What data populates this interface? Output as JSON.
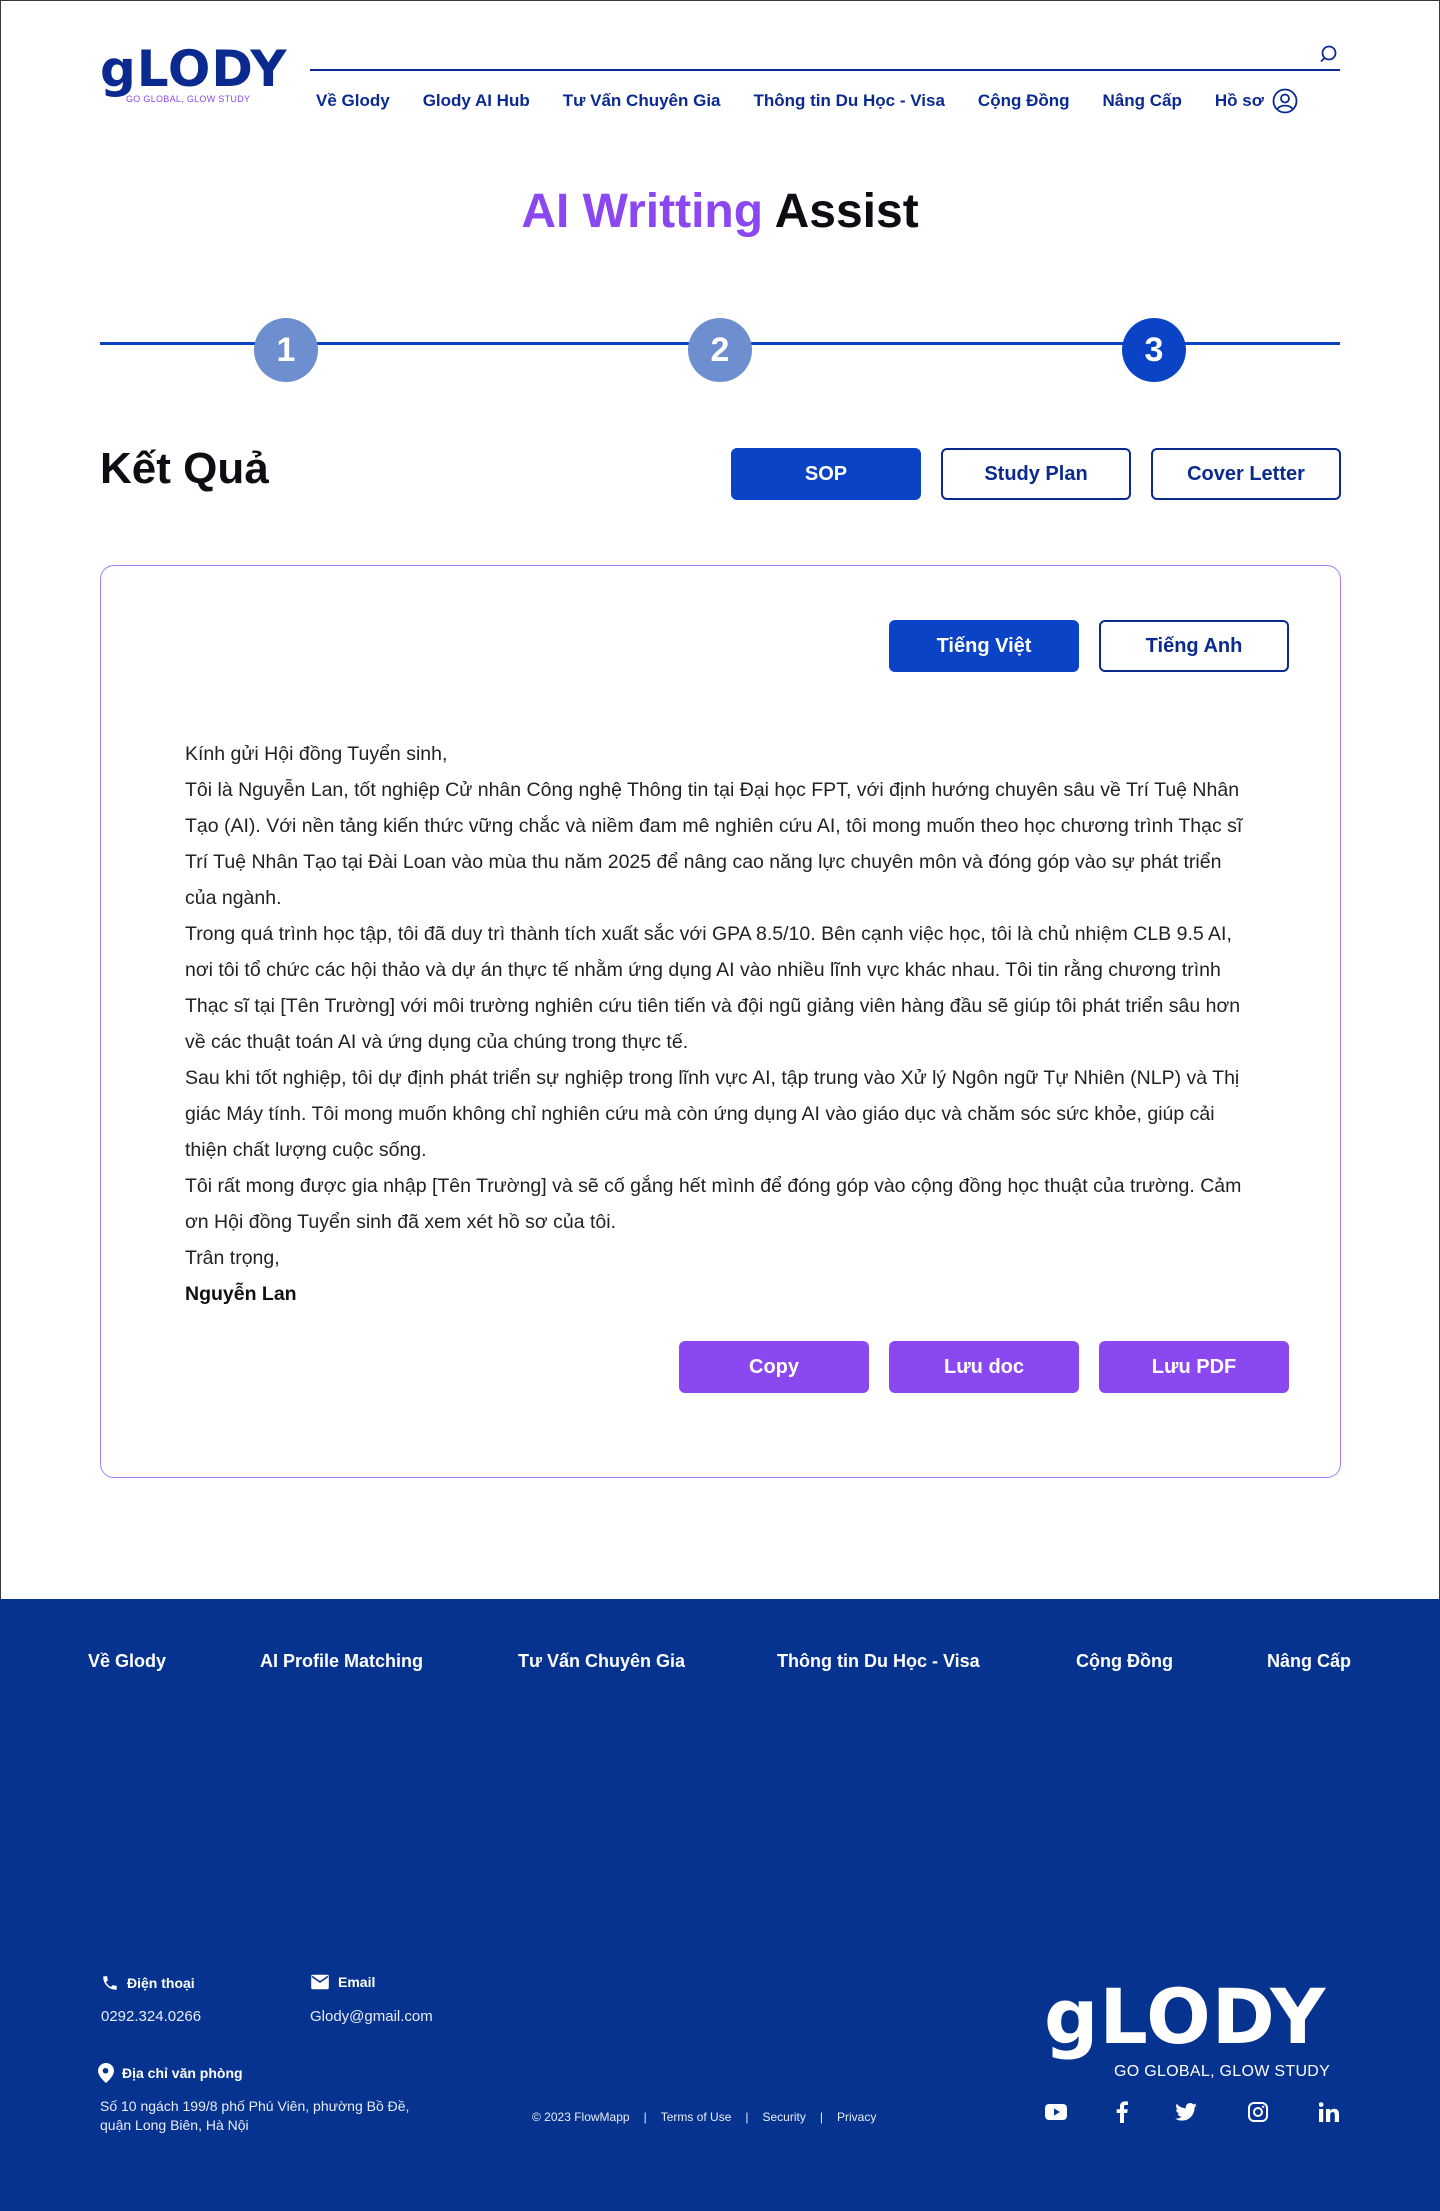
{
  "header": {
    "logo_text": "gLODY",
    "logo_tagline": "GO GLOBAL, GLOW STUDY",
    "nav": [
      "Về Glody",
      "Glody AI Hub",
      "Tư Vấn Chuyên Gia",
      "Thông tin Du Học - Visa",
      "Cộng Đồng",
      "Nâng Cấp",
      "Hồ sơ"
    ]
  },
  "title": {
    "accent": "AI Writting",
    "rest": "Assist"
  },
  "stepper": {
    "steps": [
      "1",
      "2",
      "3"
    ],
    "current": 3
  },
  "result": {
    "heading": "Kết Quả",
    "doc_tabs": [
      "SOP",
      "Study Plan",
      "Cover Letter"
    ],
    "active_tab": "SOP",
    "lang_tabs": [
      "Tiếng Việt",
      "Tiếng Anh"
    ],
    "active_lang": "Tiếng Việt",
    "letter": {
      "greeting": "Kính gửi Hội đồng Tuyển sinh,",
      "paragraphs": [
        "Tôi là Nguyễn Lan, tốt nghiệp Cử nhân Công nghệ Thông tin tại Đại học FPT, với định hướng chuyên sâu về Trí Tuệ Nhân Tạo (AI). Với nền tảng kiến thức vững chắc và niềm đam mê nghiên cứu AI, tôi mong muốn theo học chương trình Thạc sĩ Trí Tuệ Nhân Tạo tại Đài Loan vào mùa thu năm 2025 để nâng cao năng lực chuyên môn và đóng góp vào sự phát triển của ngành.",
        "Trong quá trình học tập, tôi đã duy trì thành tích xuất sắc với GPA 8.5/10. Bên cạnh việc học, tôi là chủ nhiệm CLB 9.5 AI, nơi tôi tổ chức các hội thảo và dự án thực tế nhằm ứng dụng AI vào nhiều lĩnh vực khác nhau. Tôi tin rằng chương trình Thạc sĩ tại [Tên Trường] với môi trường nghiên cứu tiên tiến và đội ngũ giảng viên hàng đầu sẽ giúp tôi phát triển sâu hơn về các thuật toán AI và ứng dụng của chúng trong thực tế.",
        "Sau khi tốt nghiệp, tôi dự định phát triển sự nghiệp trong lĩnh vực AI, tập trung vào Xử lý Ngôn ngữ Tự Nhiên (NLP) và Thị giác Máy tính. Tôi mong muốn không chỉ nghiên cứu mà còn ứng dụng AI vào giáo dục và chăm sóc sức khỏe, giúp cải thiện chất lượng cuộc sống.",
        "Tôi rất mong được gia nhập [Tên Trường] và sẽ cố gắng hết mình để đóng góp vào cộng đồng học thuật của trường. Cảm ơn Hội đồng Tuyển sinh đã xem xét hồ sơ của tôi."
      ],
      "closing": "Trân trọng,",
      "signature": "Nguyễn Lan"
    },
    "actions": [
      "Copy",
      "Lưu doc",
      "Lưu PDF"
    ]
  },
  "footer": {
    "nav": [
      "Về Glody",
      "AI Profile Matching",
      "Tư Vấn Chuyên Gia",
      "Thông tin Du Học - Visa",
      "Cộng Đồng",
      "Nâng Cấp"
    ],
    "phone_label": "Điện thoại",
    "phone": "0292.324.0266",
    "email_label": "Email",
    "email": "Glody@gmail.com",
    "address_label": "Địa chỉ văn phòng",
    "address": "Số 10 ngách 199/8 phố Phú Viên, phường Bồ Đề, quận Long Biên, Hà Nội",
    "legal": [
      "© 2023 FlowMapp",
      "Terms of Use",
      "Security",
      "Privacy"
    ],
    "logo_text": "gLODY",
    "logo_tagline": "GO GLOBAL, GLOW STUDY",
    "social": [
      "youtube-icon",
      "facebook-icon",
      "twitter-icon",
      "instagram-icon",
      "linkedin-icon"
    ]
  },
  "colors": {
    "primary": "#0b43c7",
    "navy": "#06338f",
    "accent": "#8b48f0"
  }
}
